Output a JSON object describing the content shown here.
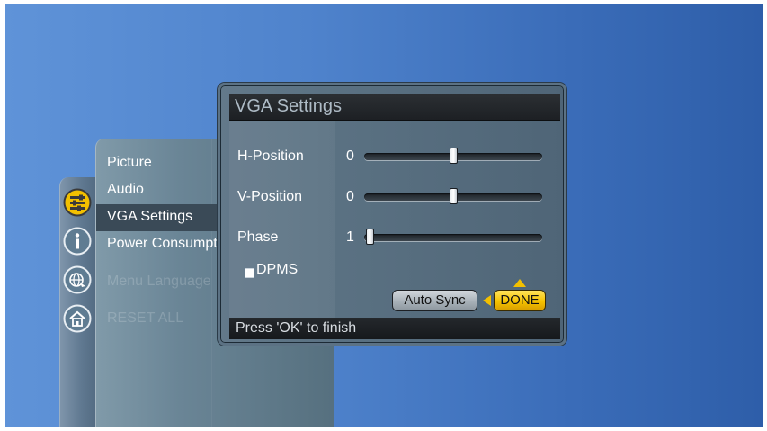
{
  "main_menu": {
    "items": [
      {
        "label": "Picture"
      },
      {
        "label": "Audio"
      },
      {
        "label": "VGA Settings"
      },
      {
        "label": "Power Consumption"
      },
      {
        "label": "Menu Language"
      },
      {
        "label": "RESET ALL"
      }
    ],
    "selected": "VGA Settings"
  },
  "icons": [
    "settings-sliders-icon",
    "info-icon",
    "globe-icon",
    "home-icon"
  ],
  "dialog": {
    "title": "VGA Settings",
    "rows": [
      {
        "label": "H-Position",
        "value": "0",
        "level": 0.5
      },
      {
        "label": "V-Position",
        "value": "0",
        "level": 0.5
      },
      {
        "label": "Phase",
        "value": "1",
        "level": 0.0
      }
    ],
    "dpms": {
      "label": "DPMS",
      "checked": false
    },
    "auto_sync_label": "Auto Sync",
    "done_label": "DONE",
    "status": "Press 'OK' to finish"
  },
  "colors": {
    "accent": "#f5c200",
    "background": "#4f83cc"
  }
}
